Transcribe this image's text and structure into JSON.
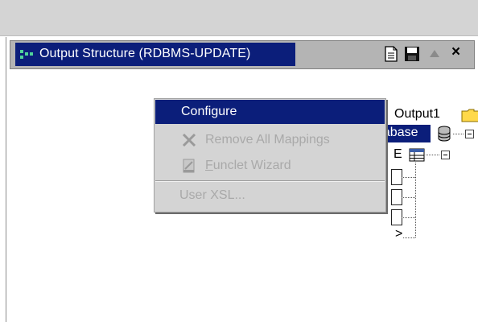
{
  "panel": {
    "title": "Output Structure (RDBMS-UPDATE)",
    "toolbar": {
      "document_icon": "document-icon",
      "save_icon": "save-icon",
      "up_icon": "triangle-up-icon",
      "close_label": "×"
    }
  },
  "tree": {
    "output_label": "Output1",
    "database_label": "Database",
    "table_fragment": "E",
    "field_fragment": ">"
  },
  "context_menu": {
    "items": [
      {
        "label": "Configure",
        "state": "selected"
      },
      {
        "label": "Remove All Mappings",
        "state": "disabled",
        "icon": "x-icon"
      },
      {
        "label": "Funclet Wizard",
        "state": "disabled",
        "icon": "wizard-icon"
      },
      {
        "label": "User XSL...",
        "state": "disabled"
      }
    ]
  },
  "colors": {
    "selection": "#0b1e7a",
    "menu_bg": "#d4d4d4",
    "disabled_text": "#a9a9a9"
  }
}
